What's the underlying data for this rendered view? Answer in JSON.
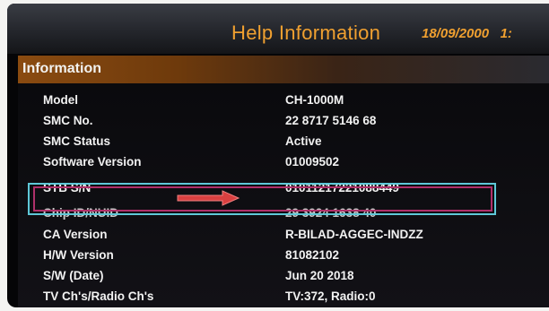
{
  "header": {
    "title": "Help Information",
    "date": "18/09/2000",
    "time_fragment": "1:"
  },
  "panel": {
    "title": "Information"
  },
  "rows": [
    {
      "label": "Model",
      "value": "CH-1000M"
    },
    {
      "label": "SMC No.",
      "value": "22 8717 5146 68"
    },
    {
      "label": "SMC Status",
      "value": "Active"
    },
    {
      "label": "Software Version",
      "value": "01009502"
    },
    {
      "label": "STB S/N",
      "value": "01011217221088449"
    },
    {
      "label": "Chip ID/NUID",
      "value": "29 3924 1638 40"
    },
    {
      "label": "CA Version",
      "value": "R-BILAD-AGGEC-INDZZ"
    },
    {
      "label": "H/W Version",
      "value": "81082102"
    },
    {
      "label": "S/W (Date)",
      "value": "Jun 20 2018"
    },
    {
      "label": "TV Ch's/Radio Ch's",
      "value": "TV:372, Radio:0"
    }
  ],
  "colors": {
    "title_text": "#f0a030",
    "highlight_outer": "#5ec8d8",
    "highlight_inner": "#b0306a",
    "arrow": "#d94040"
  },
  "icons": {
    "pointer_arrow": "right-arrow-icon"
  }
}
